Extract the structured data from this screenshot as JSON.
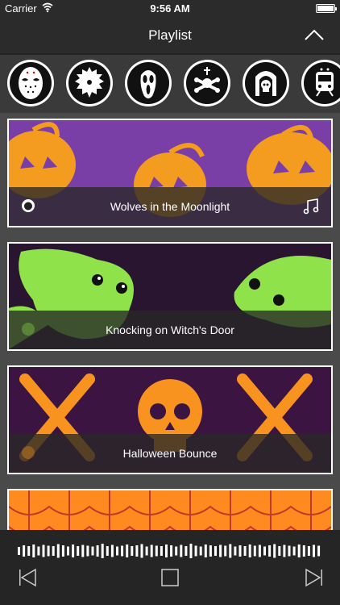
{
  "status": {
    "carrier": "Carrier",
    "time": "9:56 AM"
  },
  "nav": {
    "title": "Playlist"
  },
  "categories": [
    {
      "icon": "hockey-mask-icon"
    },
    {
      "icon": "saw-blade-icon"
    },
    {
      "icon": "scream-mask-icon"
    },
    {
      "icon": "cross-bones-icon"
    },
    {
      "icon": "skull-fireplace-icon"
    },
    {
      "icon": "ghost-train-icon"
    }
  ],
  "playlist": [
    {
      "title": "Wolves in the Moonlight",
      "icon": "pumpkin-icon",
      "playing": true
    },
    {
      "title": "Knocking on Witch's Door",
      "icon": "pumpkin-icon",
      "playing": false
    },
    {
      "title": "Halloween Bounce",
      "icon": "pumpkin-icon",
      "playing": false
    },
    {
      "title": "",
      "icon": "pumpkin-icon",
      "playing": false
    }
  ],
  "colors": {
    "bar": "#2b2b2b",
    "purple": "#7a3fa6",
    "pumpkin": "#f39c1f",
    "ghost": "#8fe24a",
    "skull": "#f7931e",
    "web": "#ff8a1f"
  }
}
